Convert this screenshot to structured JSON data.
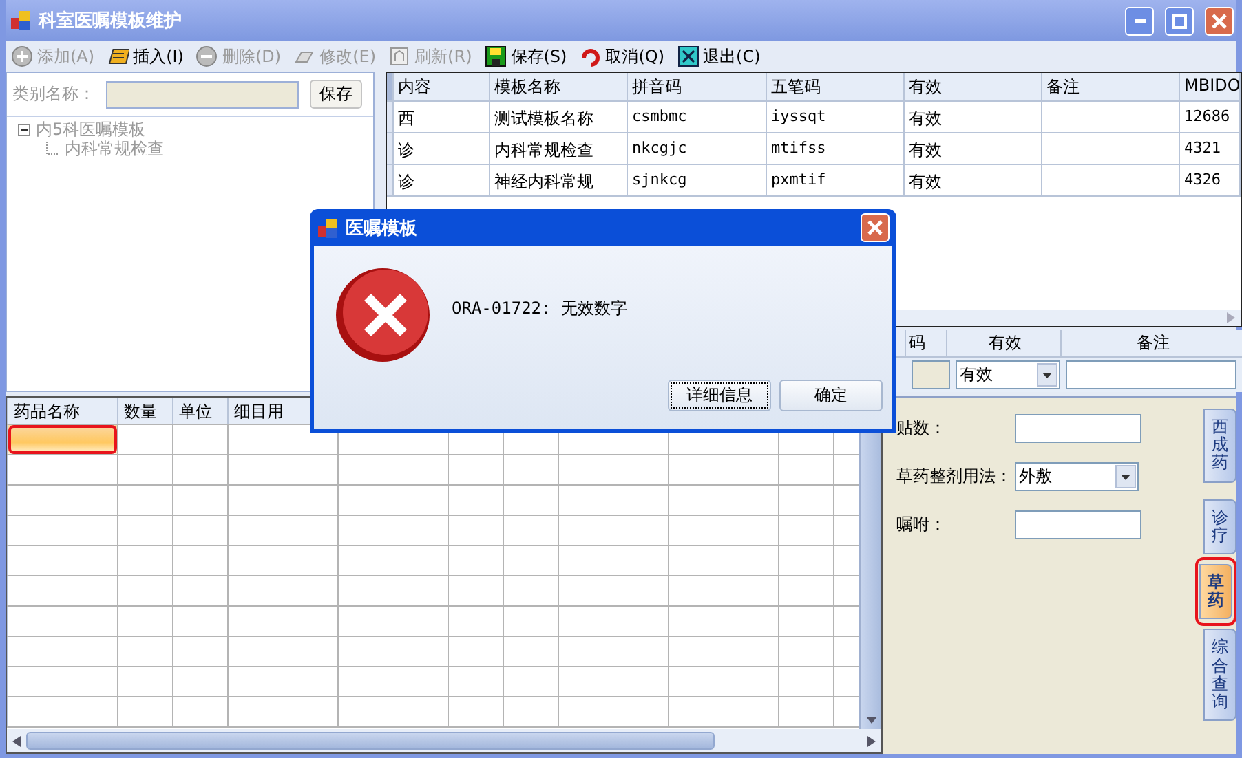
{
  "window": {
    "title": "科室医嘱模板维护"
  },
  "toolbar": [
    {
      "kind": "add",
      "label": "添加(A)",
      "disabled": true
    },
    {
      "kind": "insert",
      "label": "插入(I)",
      "disabled": false
    },
    {
      "kind": "delete",
      "label": "删除(D)",
      "disabled": true
    },
    {
      "kind": "edit",
      "label": "修改(E)",
      "disabled": true
    },
    {
      "kind": "refresh",
      "label": "刷新(R)",
      "disabled": true
    },
    {
      "kind": "save",
      "label": "保存(S)",
      "disabled": false
    },
    {
      "kind": "cancel",
      "label": "取消(Q)",
      "disabled": false
    },
    {
      "kind": "exit",
      "label": "退出(C)",
      "disabled": false
    }
  ],
  "category": {
    "label": "类别名称：",
    "disabled": true,
    "button": "保存"
  },
  "tree": [
    {
      "label": "内5科医嘱模板",
      "expanded": true,
      "children": [
        {
          "label": "内科常规检查"
        }
      ]
    }
  ],
  "template_grid": {
    "columns": [
      "内容",
      "模板名称",
      "拼音码",
      "五笔码",
      "有效",
      "备注",
      "MBIDO"
    ],
    "rows": [
      [
        "西",
        "测试模板名称",
        "csmbmc",
        "iyssqt",
        "有效",
        "",
        "12686"
      ],
      [
        "诊",
        "内科常规检查",
        "nkcgjc",
        "mtifss",
        "有效",
        "",
        "4321"
      ],
      [
        "诊",
        "神经内科常规",
        "sjnkcg",
        "pxmtif",
        "有效",
        "",
        "4326"
      ]
    ]
  },
  "edit_row": {
    "columns": [
      "码",
      "有效",
      "备注"
    ],
    "valid_value": "有效"
  },
  "drug_grid": {
    "columns": [
      "药品名称",
      "数量",
      "单位",
      "细目用"
    ],
    "rows": [
      {
        "selected": true,
        "marked": true
      },
      {
        "selected": false
      },
      {
        "selected": false
      },
      {
        "selected": false
      },
      {
        "selected": false
      },
      {
        "selected": false
      },
      {
        "selected": false
      },
      {
        "selected": false
      },
      {
        "selected": false
      },
      {
        "selected": false
      }
    ]
  },
  "herb_form": {
    "doses_label": "贴数：",
    "usage_label": "草药整剂用法：",
    "usage_value": "外敷",
    "advice_label": "嘱咐："
  },
  "side_tabs": [
    {
      "label": "西成药",
      "selected": false,
      "marked": false
    },
    {
      "label": "诊疗",
      "selected": false,
      "marked": false
    },
    {
      "label": "草药",
      "selected": true,
      "marked": true
    },
    {
      "label": "综合查询",
      "selected": false,
      "marked": false
    }
  ],
  "dialog": {
    "title": "医嘱模板",
    "message": "ORA-01722: 无效数字",
    "buttons": [
      {
        "label": "详细信息",
        "focused": true
      },
      {
        "label": "确定",
        "focused": false
      }
    ]
  }
}
